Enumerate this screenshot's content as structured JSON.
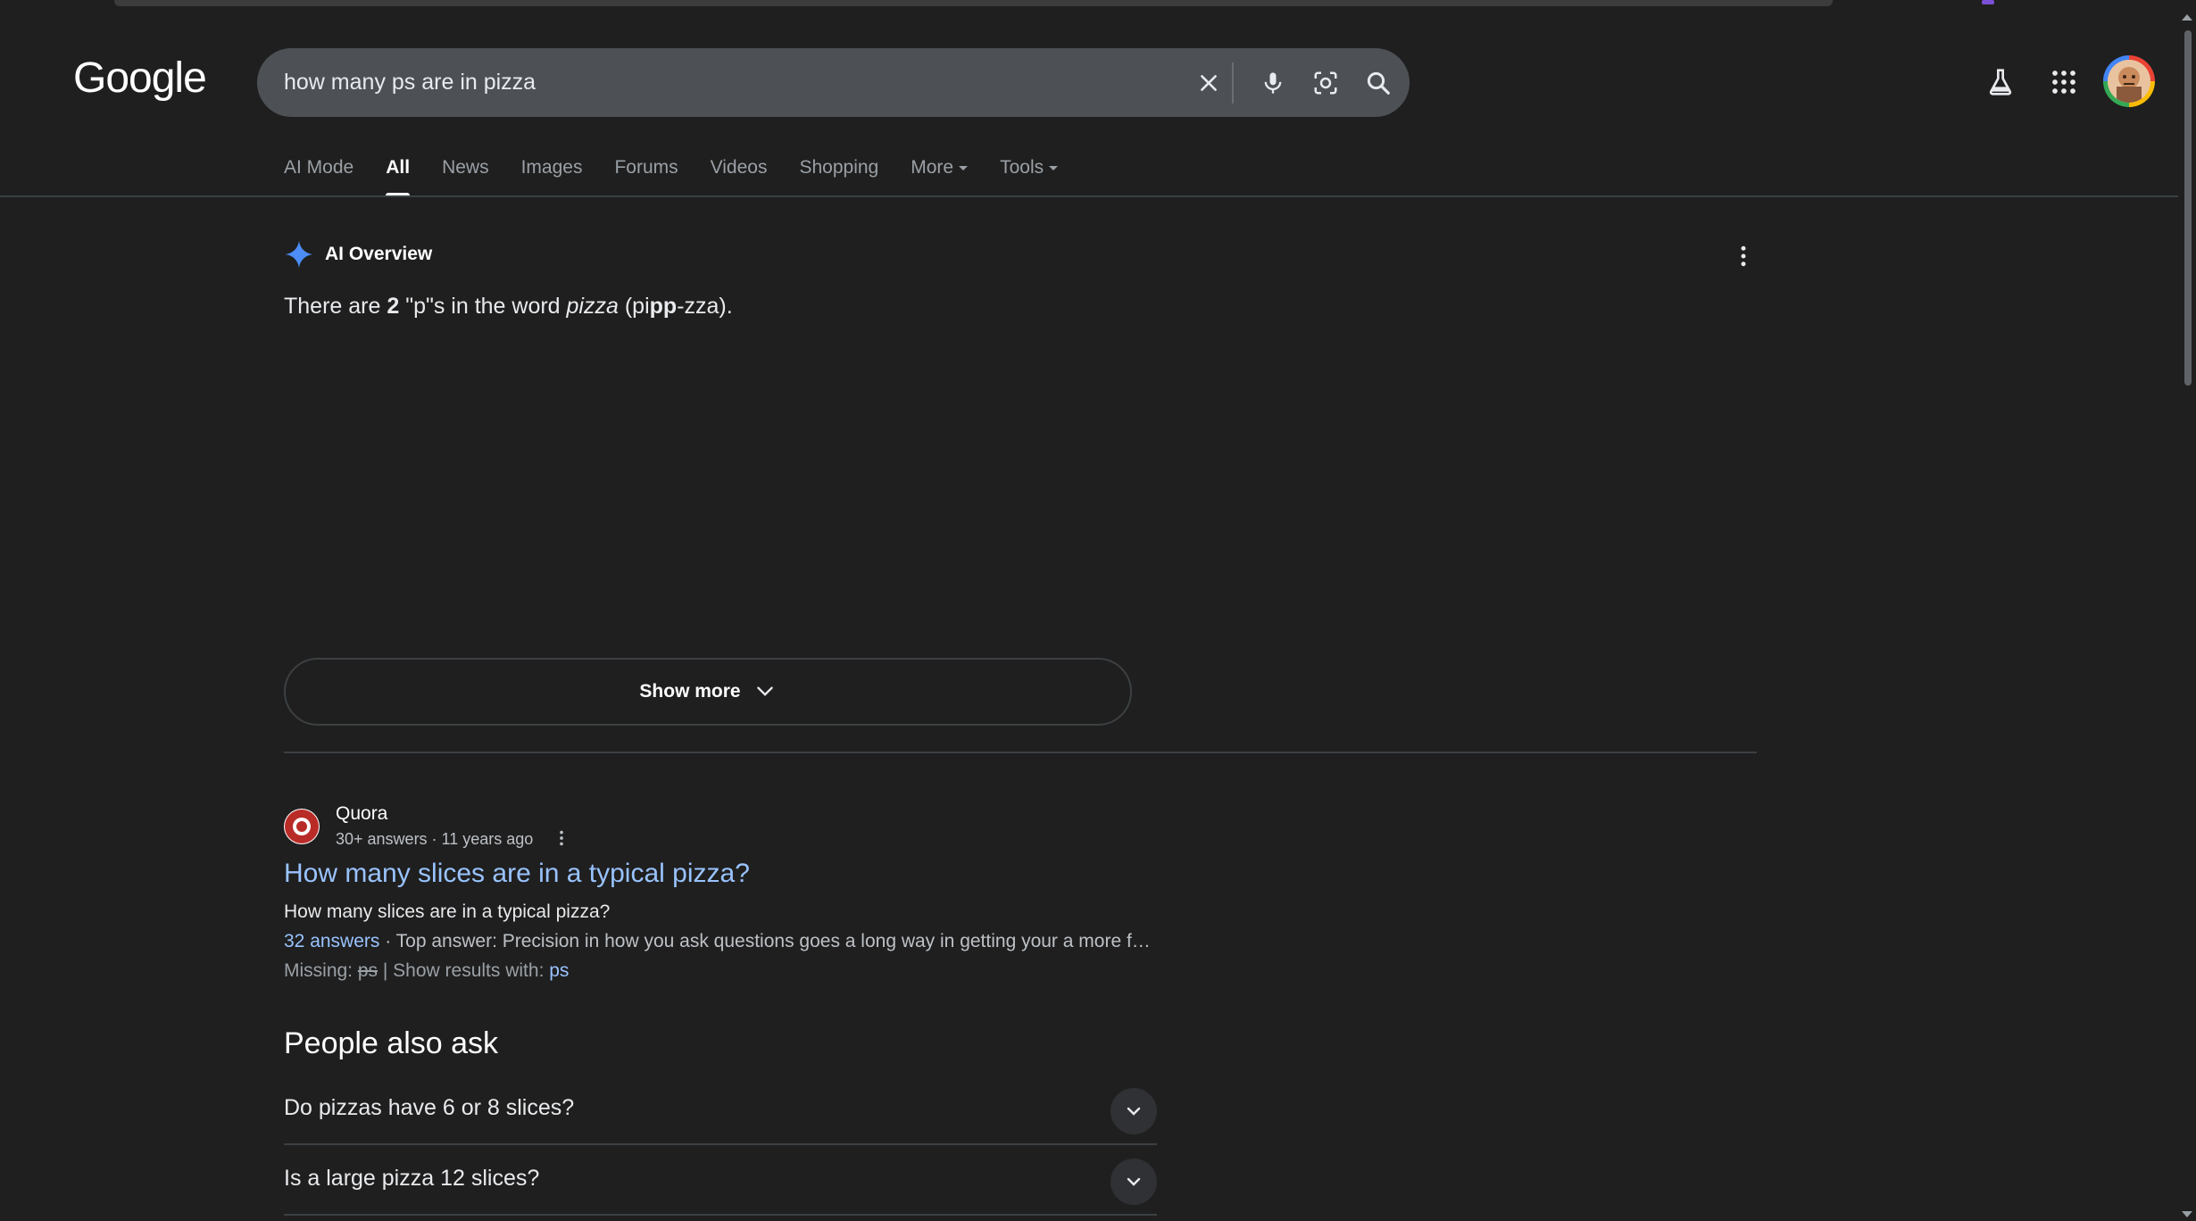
{
  "header": {
    "logo_text": "Google",
    "search": {
      "query": "how many ps are in pizza"
    }
  },
  "tabs": [
    {
      "label": "AI Mode"
    },
    {
      "label": "All"
    },
    {
      "label": "News"
    },
    {
      "label": "Images"
    },
    {
      "label": "Forums"
    },
    {
      "label": "Videos"
    },
    {
      "label": "Shopping"
    },
    {
      "label": "More"
    },
    {
      "label": "Tools"
    }
  ],
  "ai_overview": {
    "label": "AI Overview",
    "text_before": "There are ",
    "count": "2",
    "text_mid": " \"p\"s in the word ",
    "word": "pizza",
    "text_open": " (pi",
    "bold_pp": "pp",
    "text_close": "-zza).",
    "show_more": "Show more"
  },
  "result": {
    "source": "Quora",
    "meta": "30+ answers · 11 years ago",
    "title": "How many slices are in a typical pizza?",
    "snippet": "How many slices are in a typical pizza?",
    "answers_link": "32 answers",
    "top_answer": " · Top answer: Precision in how you ask questions goes a long way in getting your a more f…",
    "missing_label": "Missing: ",
    "missing_term": "ps",
    "show_results_label": " | Show results with: ",
    "show_results_term": "ps"
  },
  "people_also_ask": {
    "title": "People also ask",
    "questions": [
      "Do pizzas have 6 or 8 slices?",
      "Is a large pizza 12 slices?"
    ]
  },
  "colors": {
    "background": "#1f1f1f",
    "search_box": "#4d5156",
    "link": "#99c3ff",
    "ai_sparkle": "#4c8df6"
  }
}
